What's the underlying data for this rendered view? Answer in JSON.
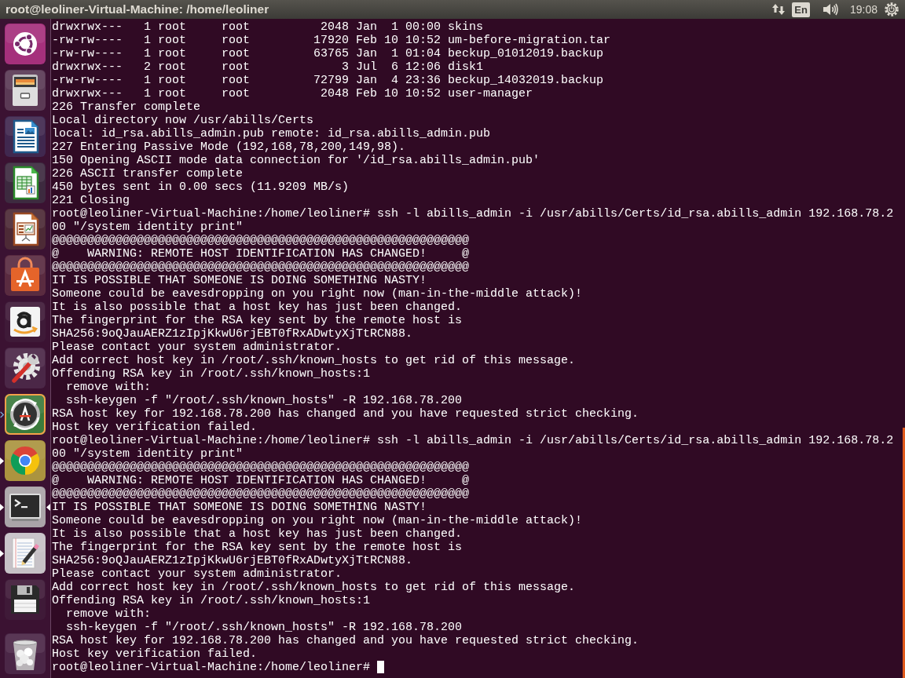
{
  "top_panel": {
    "title": "root@leoliner-Virtual-Machine: /home/leoliner",
    "keyboard_layout": "En",
    "clock": "19:08"
  },
  "launcher": [
    {
      "kind": "dash",
      "running": false,
      "focused": false,
      "urgent": false
    },
    {
      "kind": "files",
      "running": false,
      "focused": false,
      "urgent": false
    },
    {
      "kind": "writer",
      "running": false,
      "focused": false,
      "urgent": false
    },
    {
      "kind": "calc",
      "running": false,
      "focused": false,
      "urgent": false
    },
    {
      "kind": "impress",
      "running": false,
      "focused": false,
      "urgent": false
    },
    {
      "kind": "software",
      "running": false,
      "focused": false,
      "urgent": false
    },
    {
      "kind": "amazon",
      "running": false,
      "focused": false,
      "urgent": false
    },
    {
      "kind": "settings",
      "running": false,
      "focused": false,
      "urgent": false
    },
    {
      "kind": "updater",
      "running": true,
      "focused": false,
      "urgent": true
    },
    {
      "kind": "browser",
      "running": true,
      "focused": false,
      "urgent": false
    },
    {
      "kind": "terminal",
      "running": true,
      "focused": true,
      "urgent": false
    },
    {
      "kind": "editor",
      "running": true,
      "focused": false,
      "urgent": false
    },
    {
      "kind": "floppy",
      "running": false,
      "focused": false,
      "urgent": false
    },
    {
      "kind": "trash",
      "running": false,
      "focused": false,
      "urgent": false
    }
  ],
  "terminal": {
    "lines": [
      "drwxrwx---   1 root     root          2048 Jan  1 00:00 skins",
      "-rw-rw----   1 root     root         17920 Feb 10 10:52 um-before-migration.tar",
      "-rw-rw----   1 root     root         63765 Jan  1 01:04 beckup_01012019.backup",
      "drwxrwx---   2 root     root             3 Jul  6 12:06 disk1",
      "-rw-rw----   1 root     root         72799 Jan  4 23:36 beckup_14032019.backup",
      "drwxrwx---   1 root     root          2048 Feb 10 10:52 user-manager",
      "226 Transfer complete",
      "Local directory now /usr/abills/Certs",
      "local: id_rsa.abills_admin.pub remote: id_rsa.abills_admin.pub",
      "227 Entering Passive Mode (192,168,78,200,149,98).",
      "150 Opening ASCII mode data connection for '/id_rsa.abills_admin.pub'",
      "226 ASCII transfer complete",
      "450 bytes sent in 0.00 secs (11.9209 MB/s)",
      "221 Closing",
      "root@leoliner-Virtual-Machine:/home/leoliner# ssh -l abills_admin -i /usr/abills/Certs/id_rsa.abills_admin 192.168.78.2",
      "00 \"/system identity print\"",
      "@@@@@@@@@@@@@@@@@@@@@@@@@@@@@@@@@@@@@@@@@@@@@@@@@@@@@@@@@@@",
      "@    WARNING: REMOTE HOST IDENTIFICATION HAS CHANGED!     @",
      "@@@@@@@@@@@@@@@@@@@@@@@@@@@@@@@@@@@@@@@@@@@@@@@@@@@@@@@@@@@",
      "IT IS POSSIBLE THAT SOMEONE IS DOING SOMETHING NASTY!",
      "Someone could be eavesdropping on you right now (man-in-the-middle attack)!",
      "It is also possible that a host key has just been changed.",
      "The fingerprint for the RSA key sent by the remote host is",
      "SHA256:9oQJauAERZ1zIpjKkwU6rjEBT0fRxADwtyXjTtRCN88.",
      "Please contact your system administrator.",
      "Add correct host key in /root/.ssh/known_hosts to get rid of this message.",
      "Offending RSA key in /root/.ssh/known_hosts:1",
      "  remove with:",
      "  ssh-keygen -f \"/root/.ssh/known_hosts\" -R 192.168.78.200",
      "RSA host key for 192.168.78.200 has changed and you have requested strict checking.",
      "Host key verification failed.",
      "root@leoliner-Virtual-Machine:/home/leoliner# ssh -l abills_admin -i /usr/abills/Certs/id_rsa.abills_admin 192.168.78.2",
      "00 \"/system identity print\"",
      "@@@@@@@@@@@@@@@@@@@@@@@@@@@@@@@@@@@@@@@@@@@@@@@@@@@@@@@@@@@",
      "@    WARNING: REMOTE HOST IDENTIFICATION HAS CHANGED!     @",
      "@@@@@@@@@@@@@@@@@@@@@@@@@@@@@@@@@@@@@@@@@@@@@@@@@@@@@@@@@@@",
      "IT IS POSSIBLE THAT SOMEONE IS DOING SOMETHING NASTY!",
      "Someone could be eavesdropping on you right now (man-in-the-middle attack)!",
      "It is also possible that a host key has just been changed.",
      "The fingerprint for the RSA key sent by the remote host is",
      "SHA256:9oQJauAERZ1zIpjKkwU6rjEBT0fRxADwtyXjTtRCN88.",
      "Please contact your system administrator.",
      "Add correct host key in /root/.ssh/known_hosts to get rid of this message.",
      "Offending RSA key in /root/.ssh/known_hosts:1",
      "  remove with:",
      "  ssh-keygen -f \"/root/.ssh/known_hosts\" -R 192.168.78.200",
      "RSA host key for 192.168.78.200 has changed and you have requested strict checking.",
      "Host key verification failed.",
      "root@leoliner-Virtual-Machine:/home/leoliner#"
    ],
    "cursor": true
  }
}
